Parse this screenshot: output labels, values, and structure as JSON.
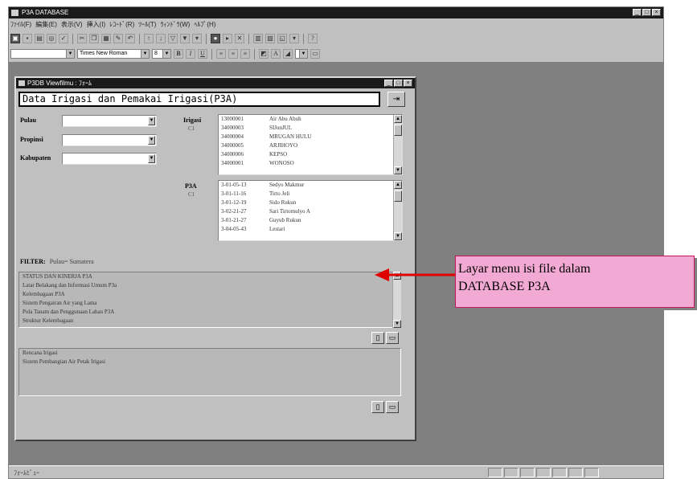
{
  "app": {
    "title": "P3A DATABASE",
    "menu": [
      "ﾌｧｲﾙ(F)",
      "編集(E)",
      "表示(V)",
      "挿入(I)",
      "ﾚｺｰﾄﾞ(R)",
      "ﾂｰﾙ(T)",
      "ｳｨﾝﾄﾞｳ(W)",
      "ﾍﾙﾌﾟ(H)"
    ],
    "font_name": "Times New Roman",
    "font_size": "8",
    "status_text": "ﾌｫｰﾑﾋﾞｭｰ"
  },
  "form": {
    "title": "P3DB Viewfilmu : ﾌｫｰﾑ",
    "header": "Data Irigasi dan Pemakai Irigasi(P3A)",
    "labels": {
      "pulau": "Pulau",
      "propinsi": "Propinsi",
      "kabupaten": "Kabupaten",
      "irigasi": "Irigasi",
      "irigasi_count": "C1",
      "p3a": "P3A",
      "p3a_count": "C1",
      "filter_label": "FILTER:",
      "filter_value": "Pulau= Sumatera"
    },
    "irigasi_list": [
      {
        "code": "13000001",
        "name": "Air Abu Abuh"
      },
      {
        "code": "34000003",
        "name": "SIJunJUL"
      },
      {
        "code": "34000004",
        "name": "MRUGAN HULU"
      },
      {
        "code": "34000005",
        "name": "ARJIHOYO"
      },
      {
        "code": "34000006",
        "name": "KEPSO"
      },
      {
        "code": "34000001",
        "name": "WONOSO"
      }
    ],
    "p3a_list": [
      {
        "code": "3-01-05-13",
        "name": "Sedyo Makmur"
      },
      {
        "code": "3-01-11-16",
        "name": "Tirto Jeli"
      },
      {
        "code": "3-01-12-19",
        "name": "Sido Rukun"
      },
      {
        "code": "3-02-21-27",
        "name": "Sari Tirtomulyo A"
      },
      {
        "code": "3-01-21-27",
        "name": "Guyub Rukun"
      },
      {
        "code": "3-04-05-43",
        "name": "Lestari"
      }
    ],
    "memo1": [
      "STATUS DAN KINERJA P3A",
      "Latar Belakang dan Informasi Umum P3a",
      "Kelembagaan P3A",
      "Sistem Pengairan Air yang Lama",
      "Pola Tanam dan Penggunaan Lahan P3A",
      "Struktur Kelembagaan"
    ],
    "memo2": [
      "Rencana Irigasi",
      "Sistem Pembangian Air Petak Irigasi"
    ]
  },
  "callout": {
    "line1": "Layar menu isi file dalam",
    "line2": "DATABASE P3A"
  },
  "colors": {
    "callout_fill": "#f2a9d3",
    "callout_border": "#c2185b",
    "arrow": "#e00000",
    "mdi_background": "#808080",
    "titlebar": "#1a1a1a"
  }
}
